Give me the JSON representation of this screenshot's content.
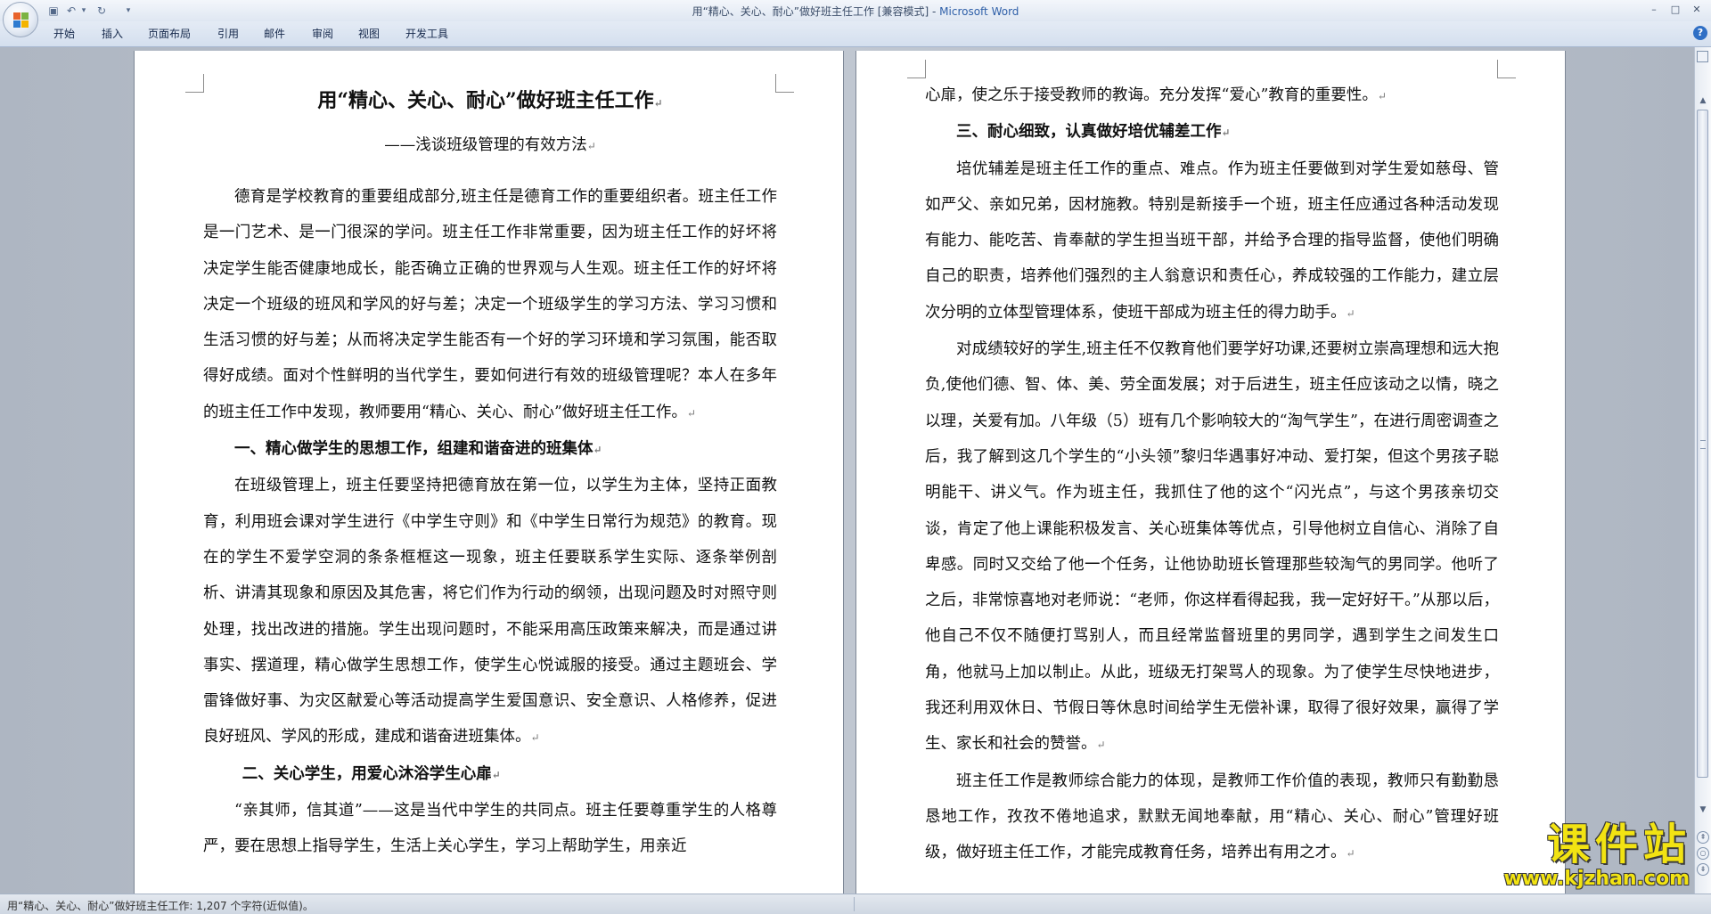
{
  "window": {
    "title_doc": "用“精心、关心、耐心”做好班主任工作 [兼容模式]",
    "title_sep": " - ",
    "title_app": "Microsoft Word",
    "min_glyph": "–",
    "max_glyph": "□",
    "close_glyph": "✕"
  },
  "quick_access": {
    "save_glyph": "▣",
    "undo_glyph": "↶",
    "undo_drop": "▾",
    "redo_glyph": "↻",
    "customize_glyph": "▾"
  },
  "ribbon": {
    "tabs": [
      "开始",
      "插入",
      "页面布局",
      "引用",
      "邮件",
      "审阅",
      "视图",
      "开发工具"
    ],
    "help_glyph": "?"
  },
  "page1": {
    "title": "用“精心、关心、耐心”做好班主任工作",
    "subtitle": "——浅谈班级管理的有效方法",
    "p1": "德育是学校教育的重要组成部分,班主任是德育工作的重要组织者。班主任工作是一门艺术、是一门很深的学问。班主任工作非常重要，因为班主任工作的好坏将决定学生能否健康地成长，能否确立正确的世界观与人生观。班主任工作的好坏将决定一个班级的班风和学风的好与差；决定一个班级学生的学习方法、学习习惯和生活习惯的好与差；从而将决定学生能否有一个好的学习环境和学习氛围，能否取得好成绩。面对个性鲜明的当代学生，要如何进行有效的班级管理呢？本人在多年的班主任工作中发现，教师要用“精心、关心、耐心”做好班主任工作。",
    "h1": "一、精心做学生的思想工作，组建和谐奋进的班集体",
    "p2": "在班级管理上，班主任要坚持把德育放在第一位，以学生为主体，坚持正面教育，利用班会课对学生进行《中学生守则》和《中学生日常行为规范》的教育。现在的学生不爱学空洞的条条框框这一现象，班主任要联系学生实际、逐条举例剖析、讲清其现象和原因及其危害，将它们作为行动的纲领，出现问题及时对照守则处理，找出改进的措施。学生出现问题时，不能采用高压政策来解决，而是通过讲事实、摆道理，精心做学生思想工作，使学生心悦诚服的接受。通过主题班会、学雷锋做好事、为灾区献爱心等活动提高学生爱国意识、安全意识、人格修养，促进良好班风、学风的形成，建成和谐奋进班集体。",
    "h2": "二、关心学生，用爱心沐浴学生心扉",
    "p3": "“亲其师，信其道”——这是当代中学生的共同点。班主任要尊重学生的人格尊严，要在思想上指导学生，生活上关心学生，学习上帮助学生，用亲近"
  },
  "page2": {
    "p0": "心扉，使之乐于接受教师的教诲。充分发挥“爱心”教育的重要性。",
    "h3": "三、耐心细致，认真做好培优辅差工作",
    "p1": "培优辅差是班主任工作的重点、难点。作为班主任要做到对学生爱如慈母、管如严父、亲如兄弟，因材施教。特别是新接手一个班，班主任应通过各种活动发现有能力、能吃苦、肯奉献的学生担当班干部，并给予合理的指导监督，使他们明确自己的职责，培养他们强烈的主人翁意识和责任心，养成较强的工作能力，建立层次分明的立体型管理体系，使班干部成为班主任的得力助手。",
    "p2": "对成绩较好的学生,班主任不仅教育他们要学好功课,还要树立崇高理想和远大抱负,使他们德、智、体、美、劳全面发展；对于后进生，班主任应该动之以情，晓之以理，关爱有加。八年级（5）班有几个影响较大的“淘气学生”，在进行周密调查之后，我了解到这几个学生的“小头领”黎归华遇事好冲动、爱打架，但这个男孩子聪明能干、讲义气。作为班主任，我抓住了他的这个“闪光点”，与这个男孩亲切交谈，肯定了他上课能积极发言、关心班集体等优点，引导他树立自信心、消除了自卑感。同时又交给了他一个任务，让他协助班长管理那些较淘气的男同学。他听了之后，非常惊喜地对老师说：“老师，你这样看得起我，我一定好好干。”从那以后，他自己不仅不随便打骂别人，而且经常监督班里的男同学，遇到学生之间发生口角，他就马上加以制止。从此，班级无打架骂人的现象。为了使学生尽快地进步，我还利用双休日、节假日等休息时间给学生无偿补课，取得了很好效果，赢得了学生、家长和社会的赞誉。",
    "p3": "班主任工作是教师综合能力的体现，是教师工作价值的表现，教师只有勤勤恳恳地工作，孜孜不倦地追求，默默无闻地奉献，用“精心、关心、耐心”管理好班级，做好班主任工作，才能完成教育任务，培养出有用之才。"
  },
  "paragraph_mark": "↵",
  "status": {
    "text": "用“精心、关心、耐心”做好班主任工作: 1,207 个字符(近似值)。"
  },
  "scrollbar": {
    "up_glyph": "▲",
    "down_glyph": "▼",
    "prev_glyph": "⇞",
    "browse_glyph": "○",
    "next_glyph": "⇟"
  },
  "watermark": {
    "cn": "课件站",
    "url": "www.kjzhan.com"
  }
}
